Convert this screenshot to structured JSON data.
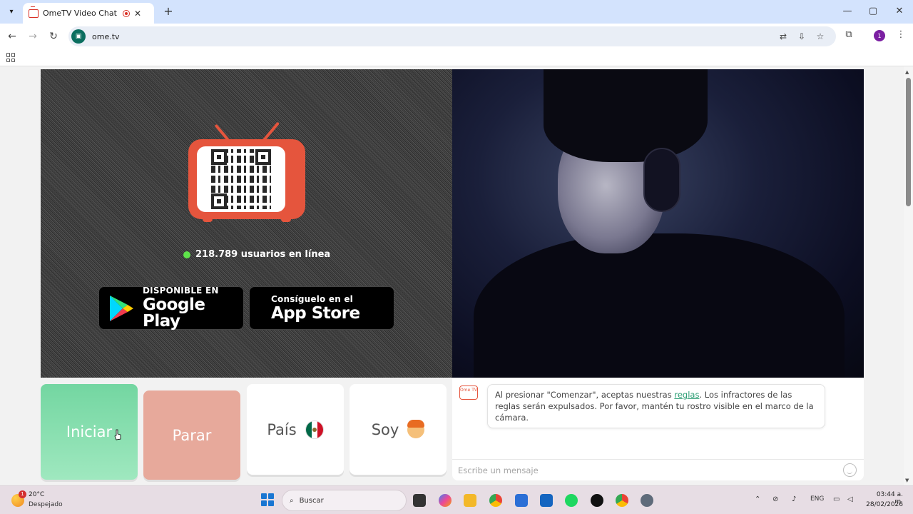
{
  "browser": {
    "tab_title": "OmeTV Video Chat — Ome",
    "tab_close": "✕",
    "new_tab": "+",
    "url": "ome.tv",
    "profile_initial": "1",
    "window_controls": {
      "minimize": "—",
      "maximize": "▢",
      "close": "✕"
    }
  },
  "page": {
    "online_count": "218.789 usuarios en línea",
    "google_play": {
      "small": "DISPONIBLE EN",
      "big": "Google Play"
    },
    "app_store": {
      "small": "Consíguelo en el",
      "big": "App Store"
    },
    "buttons": {
      "start": "Iniciar",
      "stop": "Parar",
      "country": "País",
      "iam": "Soy"
    },
    "chat": {
      "logo_text": "Ome TV",
      "message_before": "Al presionar \"Comenzar\", aceptas nuestras ",
      "message_link": "reglas",
      "message_after": ". Los infractores de las reglas serán expulsados. Por favor, mantén tu rostro visible en el marco de la cámara.",
      "input_placeholder": "Escribe un mensaje"
    }
  },
  "taskbar": {
    "weather_badge": "1",
    "temperature": "20°C",
    "weather": "Despejado",
    "search_label": "Buscar",
    "lang": "ENG",
    "time": "03:44 a. m.",
    "date": "28/02/2026"
  },
  "colors": {
    "brand_red": "#e5553d",
    "start_green": "#73d6a1",
    "stop_salmon": "#e7a99b",
    "online_dot": "#5ee24a",
    "link_green": "#2a9d73"
  }
}
